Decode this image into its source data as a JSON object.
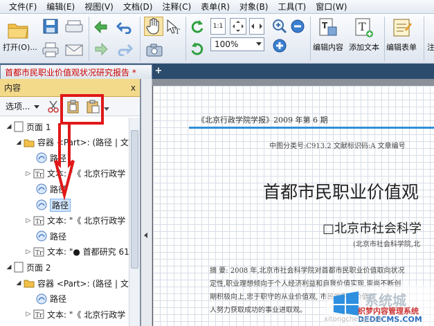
{
  "menu": [
    "文件(F)",
    "编辑(E)",
    "视图(V)",
    "文档(D)",
    "注释(C)",
    "表单(R)",
    "对象(B)",
    "工具(T)",
    "窗口(W)"
  ],
  "toolbar": {
    "open_label": "打开(O)...",
    "zoom_value": "100%",
    "edit_content_label": "编辑内容",
    "add_text_label": "添加文本",
    "edit_form_label": "编辑表单",
    "cut_off_label": "注"
  },
  "tab": {
    "title": "首都市民职业价值观状况研究报告 *",
    "new_tab": "+"
  },
  "panel": {
    "title": "内容",
    "close": "x",
    "options_label": "选项...",
    "tree": [
      {
        "exp": "◢",
        "icon": "page",
        "label": "页面 1"
      },
      {
        "exp": "◢",
        "icon": "folder",
        "label": "容器 <Part>: (路径 | 文"
      },
      {
        "exp": "",
        "icon": "path",
        "label": "路径"
      },
      {
        "exp": "▷",
        "icon": "text",
        "label": "文本: \"《 北京行政学"
      },
      {
        "exp": "",
        "icon": "path",
        "label": "路径"
      },
      {
        "exp": "",
        "icon": "path",
        "label": "路径"
      },
      {
        "exp": "▷",
        "icon": "text",
        "label": "文本: \"《 北京行政学"
      },
      {
        "exp": "",
        "icon": "path",
        "label": "路径"
      },
      {
        "exp": "▷",
        "icon": "text",
        "label": "文本: \"● 首都研究 61"
      },
      {
        "exp": "◢",
        "icon": "page",
        "label": "页面 2"
      },
      {
        "exp": "◢",
        "icon": "folder",
        "label": "容器 <Part>: (路径 | 文"
      },
      {
        "exp": "",
        "icon": "path",
        "label": "路径"
      },
      {
        "exp": "▷",
        "icon": "text",
        "label": "文本: \"《 北京行政学"
      }
    ]
  },
  "document": {
    "journal": "《北京行政学院学报》2009 年第 6 期",
    "class_line": "中图分类号:C913.2    文献标识码:A    文章编号",
    "title": "首都市民职业价值观",
    "author": "□北京市社会科学",
    "affiliation": "(北京市社会科学院,北",
    "abstract_lines": [
      "摘  要: 2008 年,北京市社会科学院对首都市民职业价值取向状况",
      "定性,职业理想倾向于个人经济利益和自我价值实现,崇尚不断创",
      "期积极向上,忠于职守的从业价值观,    市民的职业价值观",
      "人努力获取成功的事业进取观。"
    ]
  },
  "watermark": {
    "brand": "系统城",
    "line1": "织梦内容管理系统",
    "line2": "DEDECMS.COM",
    "faint": "xitongcheng.com"
  },
  "colors": {
    "annotation_red": "#e01818",
    "rule_blue": "#2f8fd6",
    "panel_head": "#f3d98a"
  }
}
